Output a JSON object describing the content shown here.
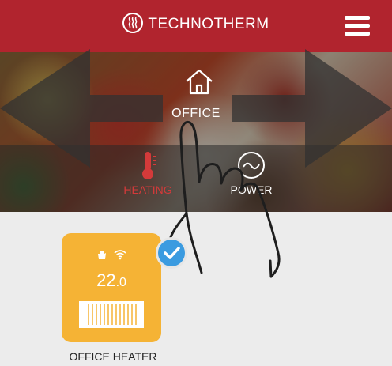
{
  "header": {
    "brand": "TECHNOTHERM",
    "brand_icon": "heat-waves-icon",
    "menu_icon": "hamburger-menu-icon"
  },
  "zone": {
    "label": "OFFICE",
    "icon": "home-icon"
  },
  "tabs": [
    {
      "label": "HEATING",
      "icon": "thermometer-icon",
      "active": true,
      "color": "#d43a3a"
    },
    {
      "label": "POWER",
      "icon": "power-meter-icon",
      "active": false,
      "color": "#ffffff"
    }
  ],
  "device": {
    "name": "OFFICE HEATER",
    "temp_whole": "22",
    "temp_decimal": ".0",
    "status_icons": [
      "hand-manual-icon",
      "wifi-icon"
    ],
    "selected": true,
    "card_color": "#f5b335",
    "badge_color": "#3b9be0"
  },
  "colors": {
    "header": "#b1242e",
    "background": "#ececec"
  }
}
